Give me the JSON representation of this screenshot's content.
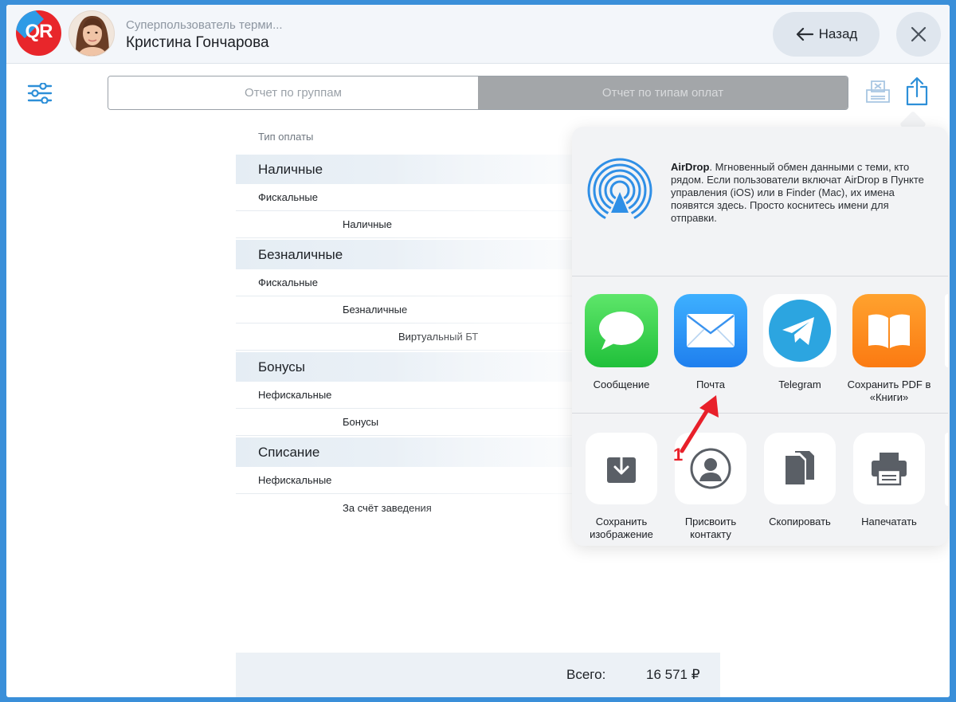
{
  "header": {
    "logo_text": "QR",
    "user_role": "Суперпользователь терми...",
    "user_name": "Кристина Гончарова",
    "back_label": "Назад"
  },
  "tabs": {
    "groups_label": "Отчет по группам",
    "payment_types_label": "Отчет по типам оплат",
    "active": "payment_types"
  },
  "report": {
    "column_header": "Тип оплаты",
    "rows": [
      {
        "kind": "group",
        "label": "Наличные"
      },
      {
        "kind": "sub",
        "level": 1,
        "label": "Фискальные"
      },
      {
        "kind": "sub",
        "level": 2,
        "label": "Наличные"
      },
      {
        "kind": "group",
        "label": "Безналичные"
      },
      {
        "kind": "sub",
        "level": 1,
        "label": "Фискальные"
      },
      {
        "kind": "sub",
        "level": 2,
        "label": "Безналичные"
      },
      {
        "kind": "sub",
        "level": 3,
        "label": "Виртуальный БТ"
      },
      {
        "kind": "group",
        "label": "Бонусы"
      },
      {
        "kind": "sub",
        "level": 1,
        "label": "Нефискальные"
      },
      {
        "kind": "sub",
        "level": 2,
        "label": "Бонусы"
      },
      {
        "kind": "group",
        "label": "Списание"
      },
      {
        "kind": "sub",
        "level": 1,
        "label": "Нефискальные"
      },
      {
        "kind": "sub",
        "level": 2,
        "label": "За счёт заведения"
      }
    ],
    "total_label": "Всего:",
    "total_value": "16 571 ₽"
  },
  "share_sheet": {
    "airdrop_title": "AirDrop",
    "airdrop_text": ". Мгновенный обмен данными с теми, кто рядом. Если пользователи включат AirDrop в Пункте управления (iOS) или в Finder (Mac), их имена появятся здесь. Просто коснитесь имени для отправки.",
    "apps": [
      {
        "label": "Сообщение",
        "icon": "messages-icon"
      },
      {
        "label": "Почта",
        "icon": "mail-icon"
      },
      {
        "label": "Telegram",
        "icon": "telegram-icon"
      },
      {
        "label": "Сохранить PDF в «Книги»",
        "icon": "books-icon"
      }
    ],
    "actions": [
      {
        "label": "Сохранить изображение",
        "icon": "save-image-icon"
      },
      {
        "label": "Присвоить контакту",
        "icon": "assign-contact-icon"
      },
      {
        "label": "Скопировать",
        "icon": "copy-icon"
      },
      {
        "label": "Напечатать",
        "icon": "print-icon"
      }
    ]
  },
  "annotation": {
    "number": "1"
  },
  "colors": {
    "frame": "#3a8fd9",
    "accent_blue": "#2d8fd8",
    "annotation_red": "#e8202a",
    "logo_red": "#e8262b"
  }
}
